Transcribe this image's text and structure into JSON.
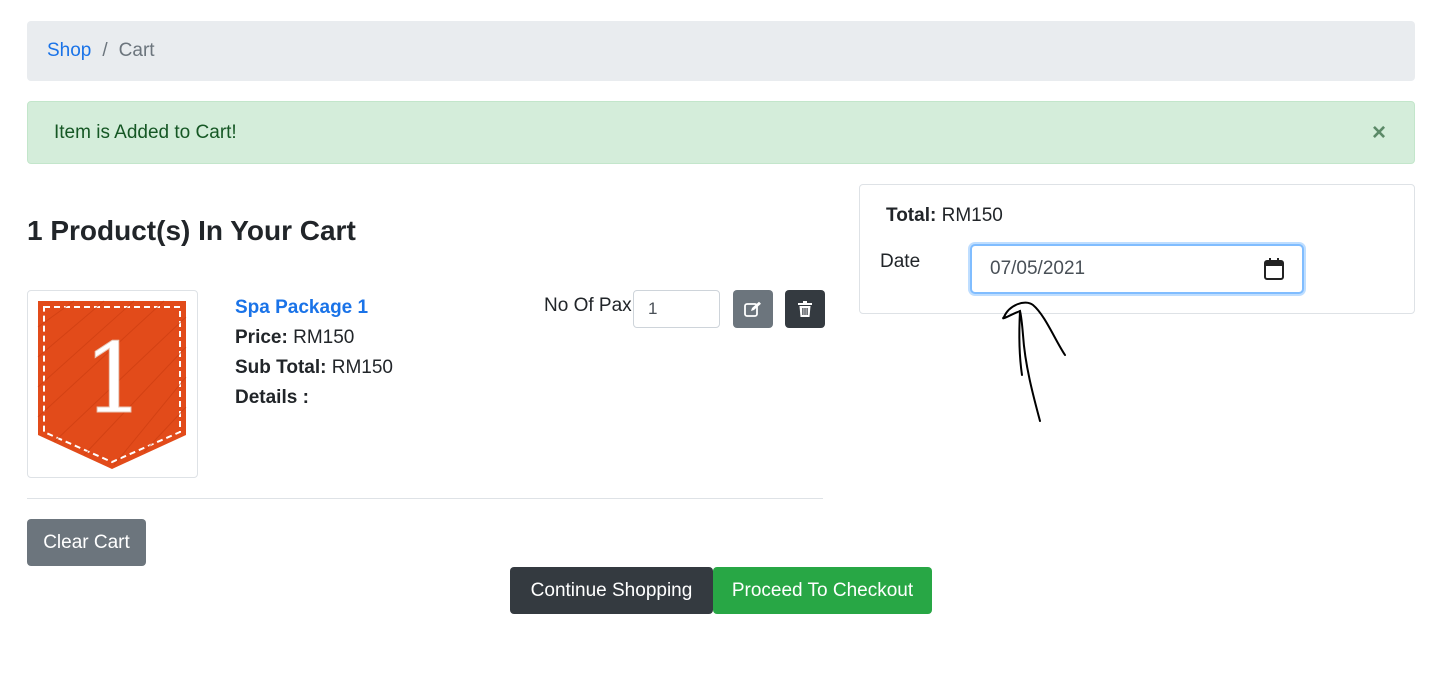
{
  "breadcrumb": {
    "shop": "Shop",
    "separator": "/",
    "current": "Cart"
  },
  "alert": {
    "message": "Item is Added to Cart!",
    "close": "×"
  },
  "cart": {
    "heading": "1 Product(s) In Your Cart",
    "item": {
      "name": "Spa Package 1",
      "price_label": "Price:",
      "price": "RM150",
      "subtotal_label": "Sub Total:",
      "subtotal": "RM150",
      "details_label": "Details :",
      "pax_label": "No Of Pax",
      "pax_value": "1",
      "thumbnail_number": "1"
    },
    "icons": {
      "edit": "edit-icon",
      "delete": "trash-icon"
    },
    "colors": {
      "thumb_orange": "#e24b1a",
      "link_blue": "#1a73e8"
    }
  },
  "buttons": {
    "clear": "Clear Cart",
    "continue": "Continue Shopping",
    "checkout": "Proceed To Checkout"
  },
  "summary": {
    "total_label": "Total:",
    "total": "RM150",
    "date_label": "Date",
    "date_value": "07/05/2021"
  }
}
